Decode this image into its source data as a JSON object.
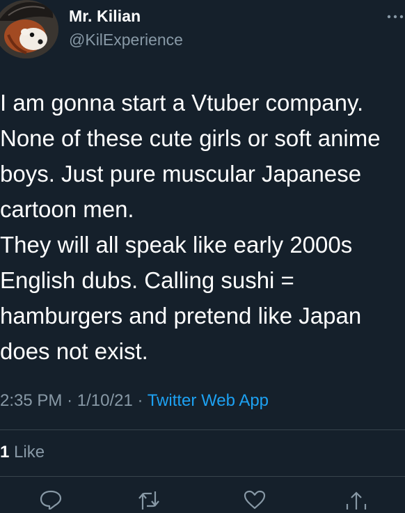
{
  "author": {
    "name": "Mr. Kilian",
    "handle": "@KilExperience"
  },
  "menu_icon": "more-horizontal-icon",
  "tweet": {
    "text": "I am gonna start a Vtuber company.\nNone of these cute girls or soft anime\nboys. Just pure muscular Japanese\ncartoon men.\nThey will all speak like early 2000s\nEnglish dubs. Calling sushi =\nhamburgers and pretend like Japan\ndoes not exist."
  },
  "meta": {
    "time": "2:35 PM",
    "separator": "·",
    "date": "1/10/21",
    "source": "Twitter Web App"
  },
  "stats": {
    "like_count": "1",
    "like_label": "Like"
  },
  "actions": [
    {
      "icon": "reply-icon"
    },
    {
      "icon": "retweet-icon"
    },
    {
      "icon": "like-icon"
    },
    {
      "icon": "share-icon"
    }
  ],
  "colors": {
    "background": "#15202b",
    "primary_text": "#ffffff",
    "secondary_text": "#8899a6",
    "link": "#1da1f2",
    "divider": "#38444d"
  }
}
